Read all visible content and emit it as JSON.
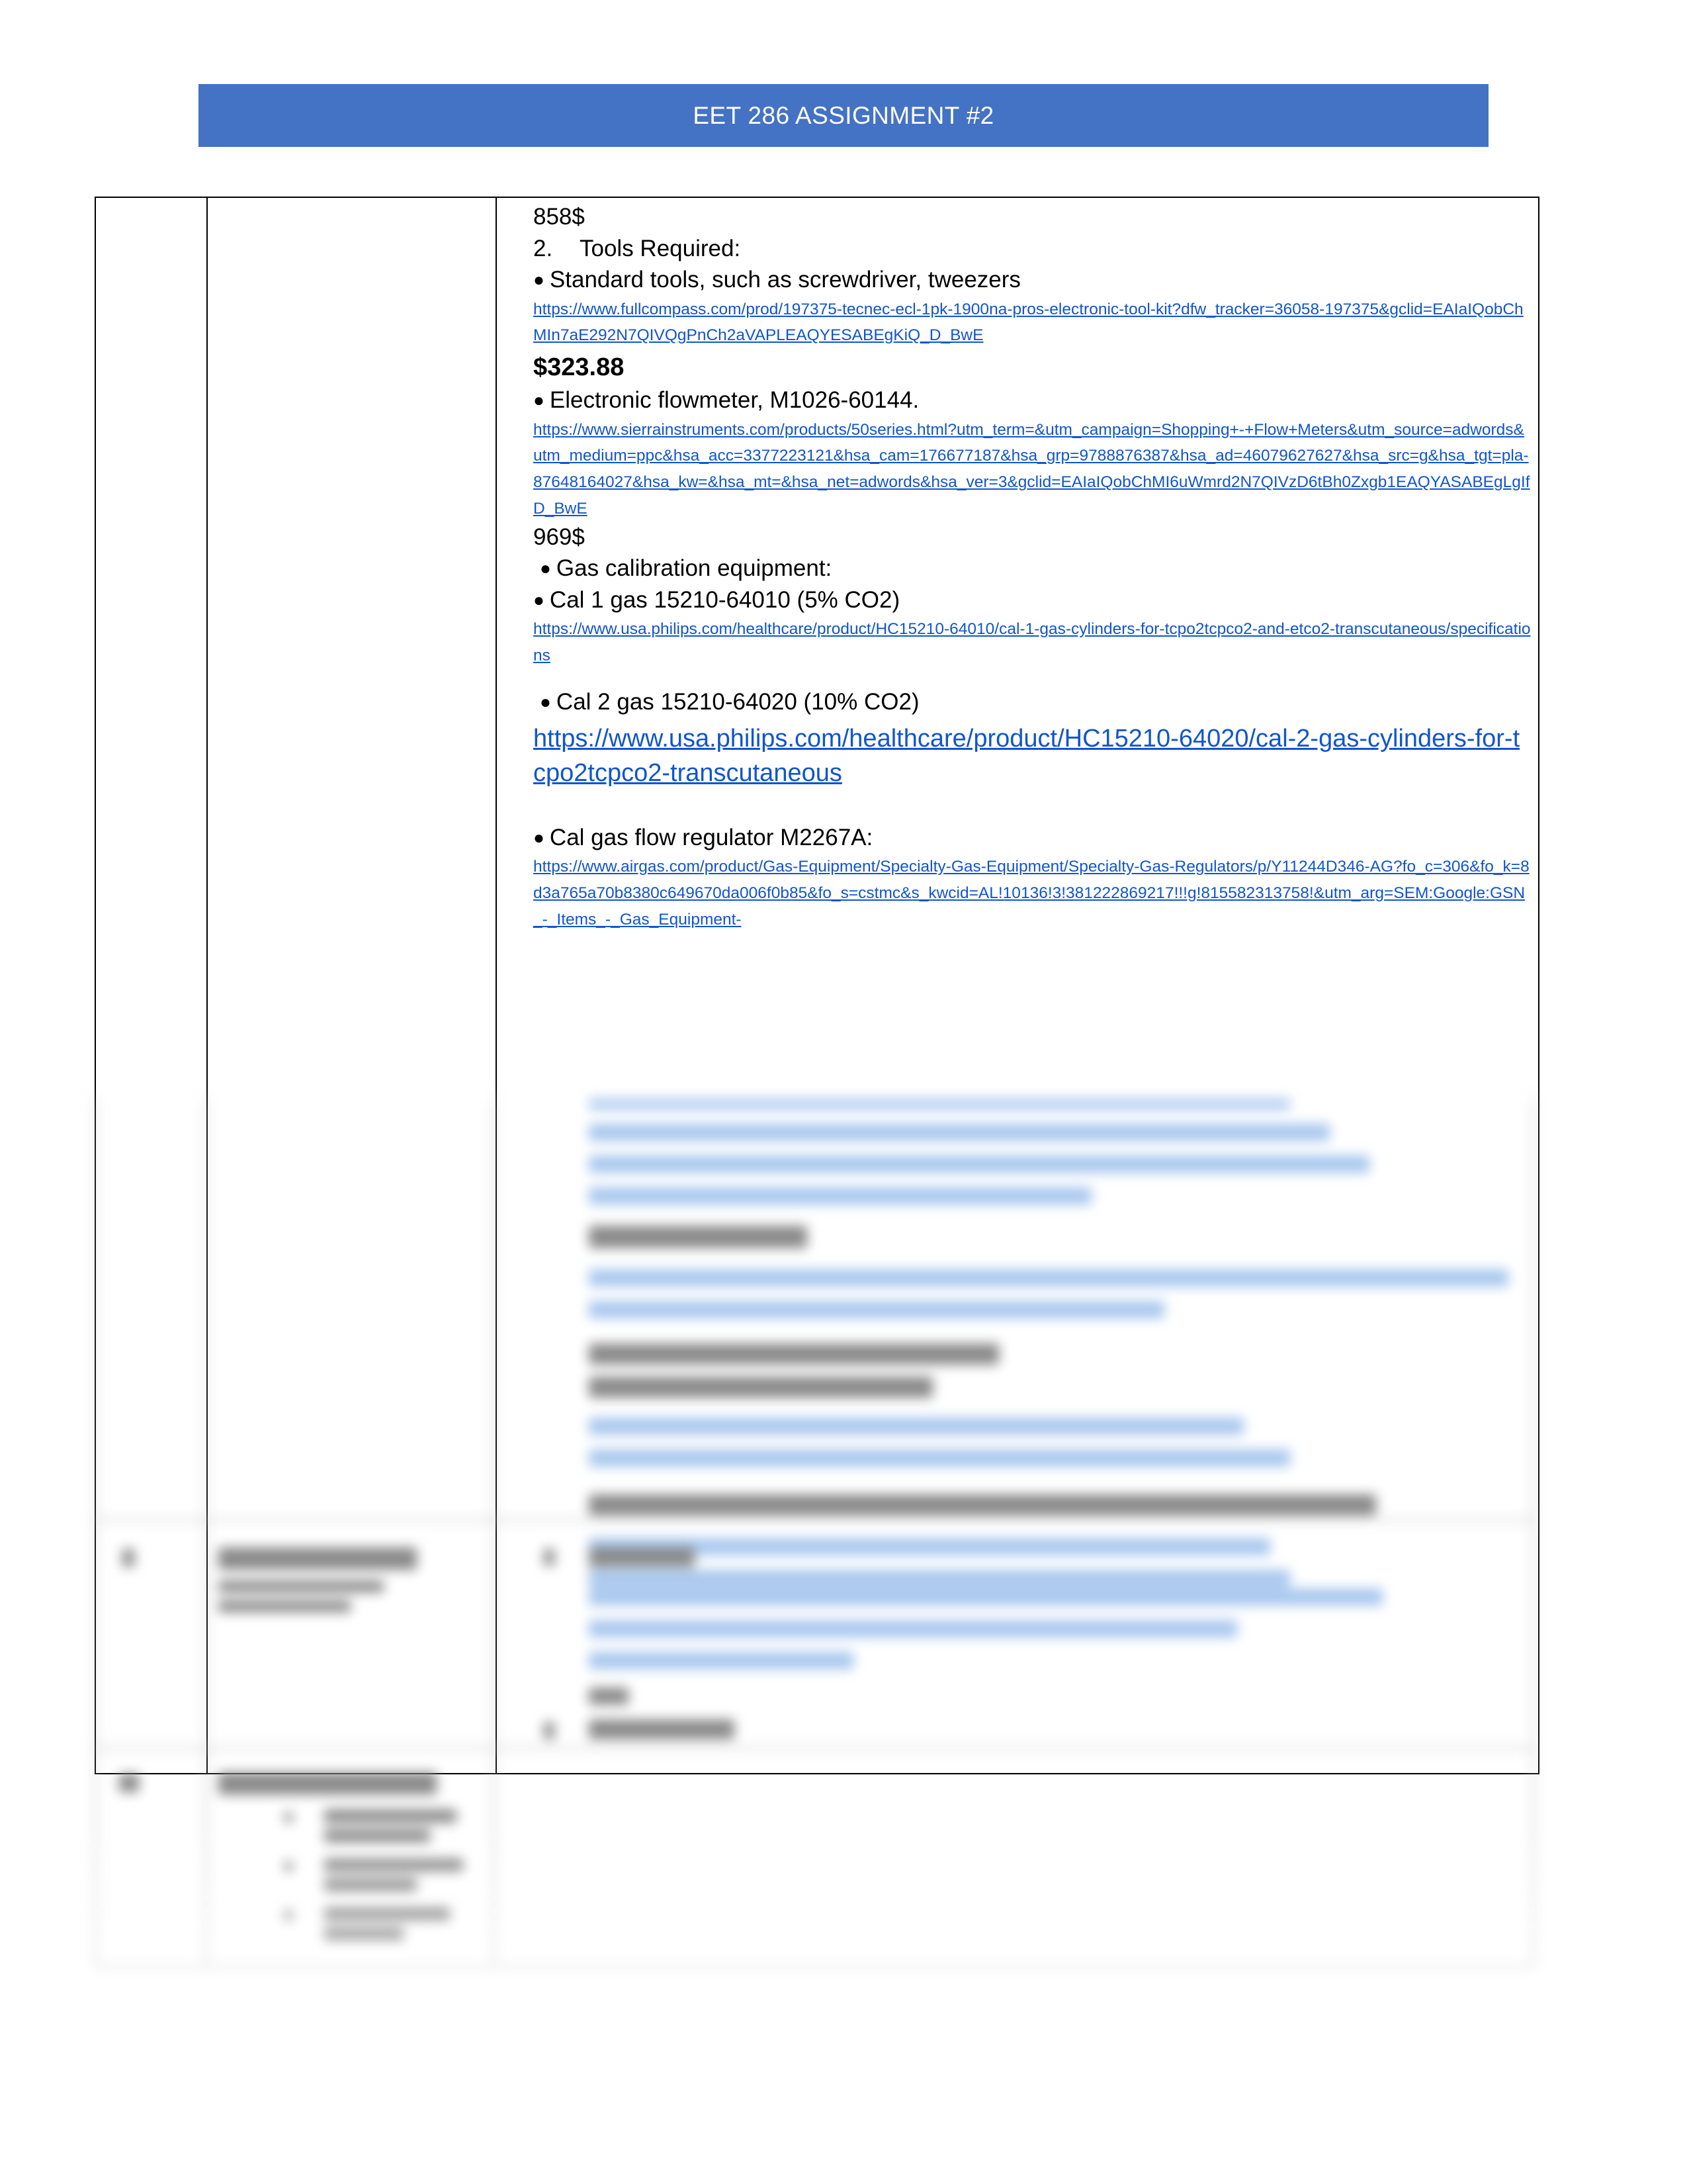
{
  "document": {
    "title_banner": "EET 286 ASSIGNMENT #2"
  },
  "table": {
    "row_sections": [
      {
        "number": "",
        "label": "",
        "content_id": "tools-required"
      }
    ]
  },
  "content": {
    "price_858": "858$",
    "item_number_2": "2.",
    "tools_required_heading": "Tools Required:",
    "bullet_standard_tools": "Standard tools, such as screwdriver, tweezers",
    "url_fullcompass": "https://www.fullcompass.com/prod/197375-tecnec-ecl-1pk-1900na-pros-electronic-tool-kit?dfw_tracker=36058-197375&gclid=EAIaIQobChMIn7aE292N7QIVQgPnCh2aVAPLEAQYESABEgKiQ_D_BwE",
    "price_32388": "$323.88",
    "bullet_flowmeter": "Electronic flowmeter, M1026-60144.",
    "url_sierra": "https://www.sierrainstruments.com/products/50series.html?utm_term=&utm_campaign=Shopping+-+Flow+Meters&utm_source=adwords&utm_medium=ppc&hsa_acc=3377223121&hsa_cam=176677187&hsa_grp=9788876387&hsa_ad=46079627627&hsa_src=g&hsa_tgt=pla-87648164027&hsa_kw=&hsa_mt=&hsa_net=adwords&hsa_ver=3&gclid=EAIaIQobChMI6uWmrd2N7QIVzD6tBh0Zxgb1EAQYASABEgLgIfD_BwE",
    "price_969": "969$",
    "bullet_gas_calibration": "Gas calibration equipment:",
    "bullet_cal1_gas": "Cal 1 gas 15210-64010 (5% CO2)",
    "url_philips_cal1": "https://www.usa.philips.com/healthcare/product/HC15210-64010/cal-1-gas-cylinders-for-tcpo2tcpco2-and-etco2-transcutaneous/specifications",
    "bullet_cal2_gas": "Cal 2 gas 15210-64020 (10% CO2)",
    "url_philips_cal2": "https://www.usa.philips.com/healthcare/product/HC15210-64020/cal-2-gas-cylinders-for-tcpo2tcpco2-transcutaneous",
    "bullet_regulator": "Cal gas flow regulator M2267A:",
    "url_airgas": "https://www.airgas.com/product/Gas-Equipment/Specialty-Gas-Equipment/Specialty-Gas-Regulators/p/Y11244D346-AG?fo_c=306&fo_k=8d3a765a70b8380c649670da006f0b85&fo_s=cstmc&s_kwcid=AL!10136!3!381222869217!!!g!815582313758!&utm_arg=SEM:Google:GSN_-_Items_-_Gas_Equipment-",
    "bullet_symbol": "●"
  },
  "colors": {
    "banner_blue": "#4472C4",
    "link_blue": "#1155CC",
    "text_black": "#000000",
    "table_border": "#000000",
    "page_background": "#FFFFFF"
  }
}
